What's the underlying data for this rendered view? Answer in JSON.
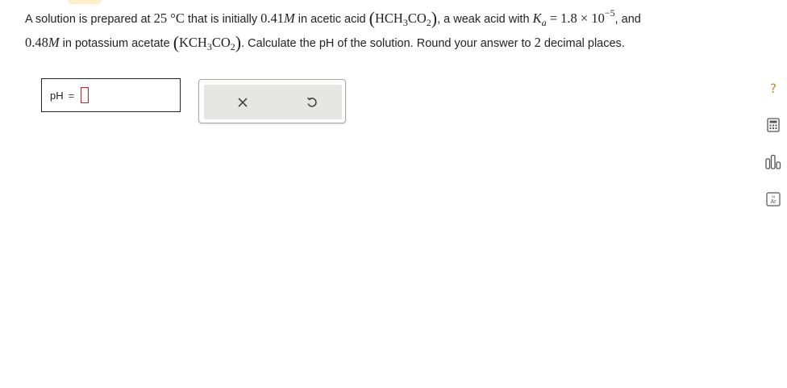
{
  "problem": {
    "l1_a": "A solution is prepared at ",
    "temp_value": "25",
    "temp_unit": " °C",
    "l1_b": " that is initially ",
    "conc1_value": "0.41",
    "conc_unit": "M",
    "l1_c": " in acetic acid ",
    "acid_a": "HCH",
    "acid_sub1": "3",
    "acid_b": "CO",
    "acid_sub2": "2",
    "l1_d": ", a weak acid with ",
    "ka_symbol": "K",
    "ka_sub": "a",
    "ka_eq": " = 1.8 × 10",
    "ka_exp": "−5",
    "l1_e": ", and",
    "conc2_value": "0.48",
    "l2_a": " in potassium acetate ",
    "salt_a": "KCH",
    "salt_sub1": "3",
    "salt_b": "CO",
    "salt_sub2": "2",
    "l2_b": ". Calculate the pH of the solution. Round your answer to ",
    "decimals": "2",
    "l2_c": " decimal places."
  },
  "answer": {
    "label": "pH",
    "equals": "=",
    "value": ""
  },
  "tools": {
    "clear": "×",
    "undo": "↺"
  },
  "side_tools": {
    "help": "?",
    "calculator_icon": "calculator-icon",
    "chart_icon": "bar-chart-icon",
    "periodic_icon": "periodic-table-icon",
    "periodic_label": "Ar"
  },
  "colors": {
    "accent": "#d0201a",
    "side_icon": "#b89030",
    "panel_bg": "#e6e6e4"
  }
}
